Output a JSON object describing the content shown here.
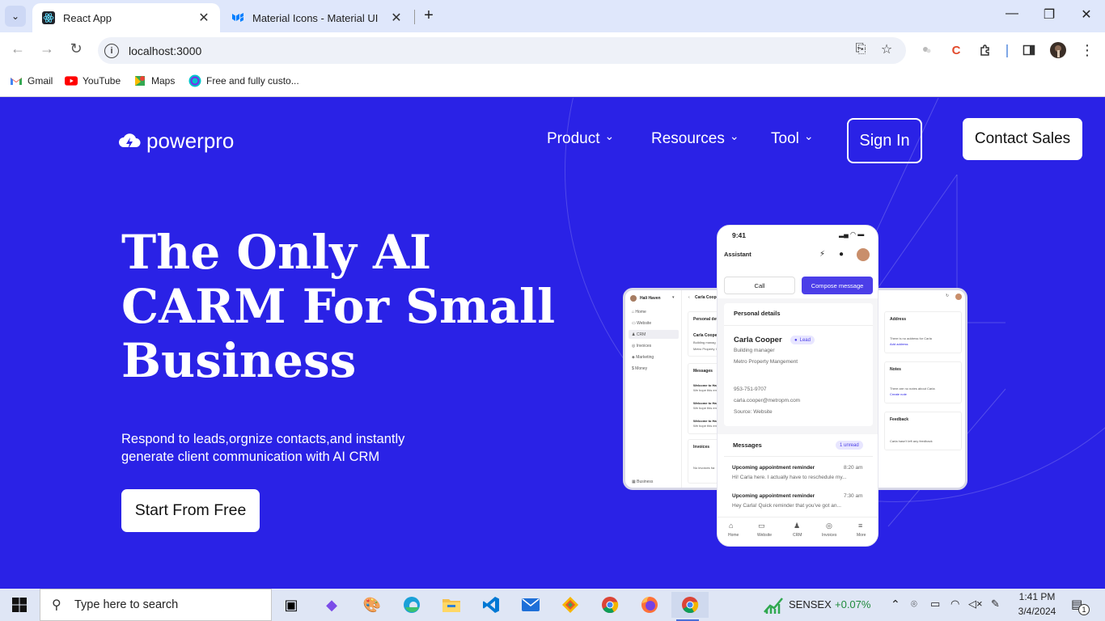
{
  "browser": {
    "tabs": [
      {
        "title": "React App",
        "active": true,
        "favicon": "react-icon"
      },
      {
        "title": "Material Icons - Material UI",
        "active": false,
        "favicon": "mui-icon"
      }
    ],
    "url": "localhost:3000",
    "bookmarks": [
      {
        "label": "Gmail",
        "icon": "gmail-icon"
      },
      {
        "label": "YouTube",
        "icon": "youtube-icon"
      },
      {
        "label": "Maps",
        "icon": "maps-icon"
      },
      {
        "label": "Free and fully custo...",
        "icon": "canva-icon"
      }
    ]
  },
  "site": {
    "brand": "powerpro",
    "nav": [
      {
        "label": "Product"
      },
      {
        "label": "Resources"
      },
      {
        "label": "Tool"
      }
    ],
    "signin_label": "Sign In",
    "contact_label": "Contact Sales",
    "hero_title": "The Only AI CARM For Small Business",
    "hero_subtitle": "Respond to leads,orgnize contacts,and instantly generate client communication with AI CRM",
    "cta_label": "Start From Free",
    "accent": "#2a22e6"
  },
  "mockup": {
    "desktop": {
      "user": "Hali Haven",
      "sidebar": [
        "Home",
        "Website",
        "CRM",
        "Invoices",
        "Marketing",
        "Money"
      ],
      "footer": "Business",
      "contact_name": "Carla Cooper",
      "personal_details": "Personal deta",
      "contact_line1": "Building manag",
      "contact_line2": "Metro Property I",
      "messages": "Messages",
      "msg1_title": "Welcome to Hali",
      "msg1_body": "We hope this em",
      "msg2_title": "Welcome to Hali",
      "msg2_body": "We hope this em",
      "msg3_title": "Welcome to Hali",
      "msg3_body": "We hope this em",
      "invoices": "Invoices",
      "no_invoices": "No invoices ha",
      "address_label": "Address",
      "address_empty": "There is no address for Carla",
      "address_add": "Add address",
      "notes_label": "Notes",
      "notes_empty": "There are no notes about Carla",
      "notes_add": "Create note",
      "feedback_label": "Feedback",
      "feedback_empty": "Carla hasn't left any feedback"
    },
    "phone": {
      "time": "9:41",
      "header": "Assistant",
      "call": "Call",
      "compose": "Compose message",
      "personal_details": "Personal details",
      "name": "Carla Cooper",
      "badge": "Lead",
      "role": "Building manager",
      "company": "Metro Property Mangement",
      "phone": "953-751-9707",
      "email": "carla.cooper@metropm.com",
      "source": "Source: Website",
      "messages": "Messages",
      "unread": "1 unread",
      "msg1_title": "Upcoming appointment reminder",
      "msg1_time": "8:20 am",
      "msg1_body": "Hi! Carla here. I actually have to reschedule my...",
      "msg2_title": "Upcoming appointment reminder",
      "msg2_time": "7:30 am",
      "msg2_body": "Hey Carla! Quick reminder that you've got an...",
      "bottom_nav": [
        "Home",
        "Website",
        "CRM",
        "Invoices",
        "More"
      ]
    }
  },
  "taskbar": {
    "search_placeholder": "Type here to search",
    "stock_name": "SENSEX",
    "stock_change": "+0.07%",
    "time": "1:41 PM",
    "date": "3/4/2024",
    "notification_count": "1"
  }
}
